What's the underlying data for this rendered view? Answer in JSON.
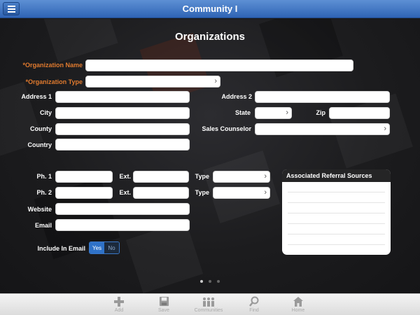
{
  "app": {
    "title": "Community I"
  },
  "page": {
    "title": "Organizations"
  },
  "form": {
    "org_name_label": "*Organization Name",
    "org_type_label": "*Organization Type",
    "address1_label": "Address 1",
    "address2_label": "Address 2",
    "city_label": "City",
    "state_label": "State",
    "zip_label": "Zip",
    "county_label": "County",
    "sales_counselor_label": "Sales Counselor",
    "country_label": "Country",
    "ph1_label": "Ph. 1",
    "ph2_label": "Ph. 2",
    "ext_label": "Ext.",
    "type_label": "Type",
    "website_label": "Website",
    "email_label": "Email",
    "include_email_label": "Include In Email",
    "toggle_yes": "Yes",
    "toggle_no": "No"
  },
  "referral": {
    "title": "Associated Referral Sources"
  },
  "pager": {
    "pages": 3,
    "current": 1
  },
  "tabbar": {
    "items": [
      {
        "label": "Add",
        "icon": "plus-icon"
      },
      {
        "label": "Save",
        "icon": "floppy-disk-icon"
      },
      {
        "label": "Communities",
        "icon": "people-icon"
      },
      {
        "label": "Find",
        "icon": "magnifier-icon"
      },
      {
        "label": "Home",
        "icon": "house-icon"
      }
    ]
  },
  "colors": {
    "header": "#2f64b5",
    "required_label": "#e07a2e",
    "toggle_on": "#2f72c8"
  }
}
